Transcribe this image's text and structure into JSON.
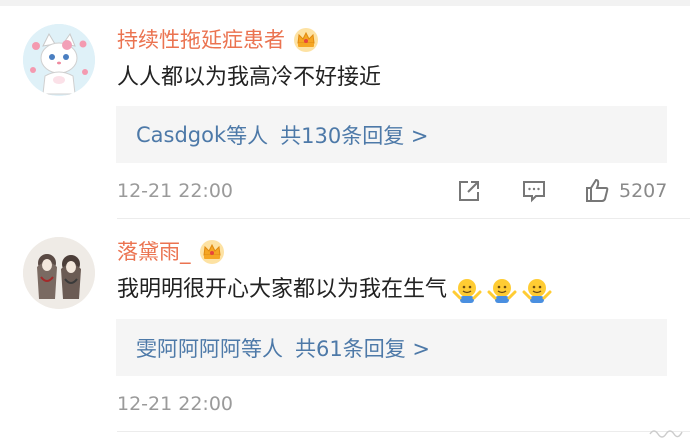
{
  "comments": [
    {
      "username": "持续性拖延症患者",
      "text": "人人都以为我高冷不好接近",
      "reply": {
        "names": "Casdgok",
        "etc": "等人",
        "count_label": "共130条回复 >"
      },
      "timestamp": "12-21 22:00",
      "like_count": "5207",
      "avatar_icon": "white-cat-avatar",
      "badge_icon": "vip-crown-icon"
    },
    {
      "username": "落黛雨_",
      "text": "我明明很开心大家都以为我在生气",
      "emojis": [
        "shrug-emoji",
        "shrug-emoji",
        "shrug-emoji"
      ],
      "reply": {
        "names": "雯阿阿阿阿",
        "etc": "等人",
        "count_label": "共61条回复 >"
      },
      "timestamp": "12-21 22:00",
      "avatar_icon": "sketch-figures-avatar",
      "badge_icon": "vip-crown-icon"
    }
  ],
  "colors": {
    "username": "#eb7350",
    "link": "#4d79a8",
    "text": "#222222",
    "meta": "#9a9a9a",
    "reply_bg": "#f5f5f5"
  }
}
